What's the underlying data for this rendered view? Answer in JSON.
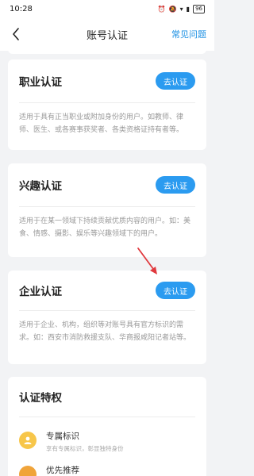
{
  "status_bar": {
    "time": "10:28",
    "battery": "96"
  },
  "header": {
    "title": "账号认证",
    "faq_link": "常见问题"
  },
  "cards": [
    {
      "title": "职业认证",
      "button": "去认证",
      "desc": "适用于具有正当职业或附加身份的用户。如教师、律师、医生、或各赛事获奖者、各类资格证持有者等。"
    },
    {
      "title": "兴趣认证",
      "button": "去认证",
      "desc": "适用于在某一领域下持续贡献优质内容的用户。如：美食、情感、摄影、娱乐等兴趣领域下的用户。"
    },
    {
      "title": "企业认证",
      "button": "去认证",
      "desc": "适用于企业、机构，组织等对账号具有官方标识的需求。如：西安市消防救援支队、华商报咸阳记者站等。"
    }
  ],
  "privileges": {
    "title": "认证特权",
    "items": [
      {
        "title": "专属标识",
        "subtitle": "享有专属标识，彰显独特身份",
        "icon": "user-badge-icon"
      },
      {
        "title": "优先推荐"
      }
    ]
  },
  "colors": {
    "accent": "#2b9bf0",
    "annotation_arrow": "#e0393e",
    "badge": "#f7c64a"
  }
}
